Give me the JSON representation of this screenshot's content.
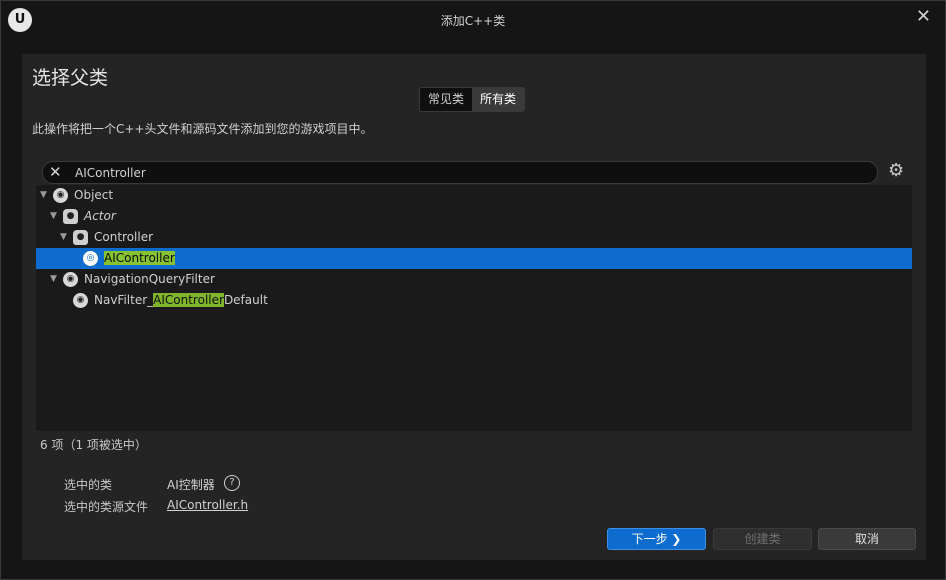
{
  "window": {
    "title": "添加C++类",
    "logo_text": "U"
  },
  "heading": "选择父类",
  "tabs": [
    {
      "label": "常见类",
      "active": false
    },
    {
      "label": "所有类",
      "active": true
    }
  ],
  "description": "此操作将把一个C++头文件和源码文件添加到您的游戏项目中。",
  "search": {
    "value": "AIController",
    "placeholder": ""
  },
  "tree": [
    {
      "label": "Object",
      "depth": 0,
      "expanded": true,
      "icon": "object-icon",
      "italic": false,
      "selected": false
    },
    {
      "label": "Actor",
      "depth": 1,
      "expanded": true,
      "icon": "actor-icon",
      "italic": true,
      "selected": false
    },
    {
      "label": "Controller",
      "depth": 2,
      "expanded": true,
      "icon": "actor-icon",
      "italic": false,
      "selected": false
    },
    {
      "label_pre": "",
      "label_hl": "AIController",
      "label_post": "",
      "depth": 3,
      "icon": "ai-controller-icon",
      "selected": true
    },
    {
      "label": "NavigationQueryFilter",
      "depth": 1,
      "expanded": true,
      "icon": "object-icon",
      "italic": false,
      "selected": false
    },
    {
      "label_pre": "NavFilter_",
      "label_hl": "AIController",
      "label_post": "Default",
      "depth": 2,
      "icon": "object-icon",
      "selected": false
    }
  ],
  "status_count": "6 项（1 项被选中）",
  "selected_class_label": "选中的类",
  "selected_class_value": "AI控制器",
  "selected_source_label": "选中的类源文件",
  "selected_source_value": "AIController.h",
  "buttons": {
    "next": "下一步 ❯",
    "create": "创建类",
    "cancel": "取消"
  },
  "colors": {
    "accent": "#0e6ccf",
    "highlight": "#7fb52a"
  }
}
